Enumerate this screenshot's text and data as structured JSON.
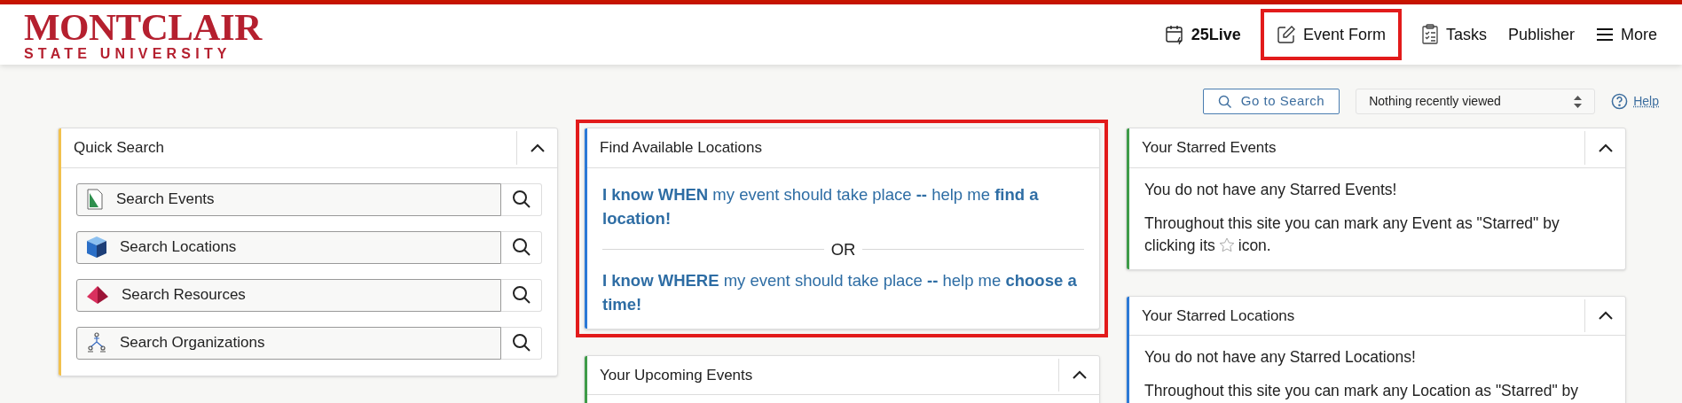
{
  "header": {
    "logo": {
      "name": "MONTCLAIR",
      "subtitle": "STATE UNIVERSITY"
    },
    "nav": [
      {
        "kind": "calendar",
        "label": "25Live",
        "bold": true,
        "highlighted": false
      },
      {
        "kind": "edit",
        "label": "Event Form",
        "bold": false,
        "highlighted": true
      },
      {
        "kind": "tasks",
        "label": "Tasks",
        "bold": false,
        "highlighted": false
      },
      {
        "kind": "none",
        "label": "Publisher",
        "bold": false,
        "highlighted": false
      },
      {
        "kind": "menu",
        "label": "More",
        "bold": false,
        "highlighted": false
      }
    ]
  },
  "toolbar": {
    "search_button": "Go to Search",
    "recent": {
      "value": "Nothing recently viewed"
    },
    "help": "Help"
  },
  "columns": [
    [
      {
        "kind": "quick_search",
        "title": "Quick Search",
        "color": "#f2c14e",
        "collapsible": true,
        "highlighted": false,
        "items": [
          {
            "kind": "events",
            "label": "Search Events"
          },
          {
            "kind": "locations",
            "label": "Search Locations"
          },
          {
            "kind": "resources",
            "label": "Search Resources"
          },
          {
            "kind": "organizations",
            "label": "Search Organizations"
          }
        ]
      }
    ],
    [
      {
        "kind": "links",
        "title": "Find Available Locations",
        "color": "#2b79d6",
        "collapsible": false,
        "highlighted": true,
        "links": [
          "**I know WHEN** my event should take place **--** help me **find a location!**",
          "**I know WHERE** my event should take place **--** help me **choose a time!**"
        ],
        "separator": "OR"
      },
      {
        "kind": "empty",
        "title": "Your Upcoming Events",
        "color": "#3e9b48",
        "collapsible": true,
        "highlighted": false
      }
    ],
    [
      {
        "kind": "message",
        "title": "Your Starred Events",
        "color": "#3e9b48",
        "collapsible": true,
        "highlighted": false,
        "message": "You do not have any Starred Events!",
        "text_before": "Throughout this site you can mark any Event as \"Starred\" by",
        "text_second": "clicking its",
        "text_after": "icon."
      },
      {
        "kind": "message",
        "title": "Your Starred Locations",
        "color": "#2b79d6",
        "collapsible": true,
        "highlighted": false,
        "message": "You do not have any Starred Locations!",
        "text_before": "Throughout this site you can mark any Location as \"Starred\" by"
      }
    ]
  ]
}
